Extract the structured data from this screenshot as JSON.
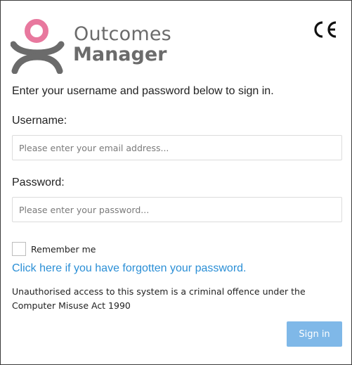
{
  "brand": {
    "line1": "Outcomes",
    "line2": "Manager",
    "logo_icon": "outcomes-person-logo-icon",
    "pink": "#e8789e",
    "grey": "#6b6b6b"
  },
  "certification": {
    "mark": "CE"
  },
  "form": {
    "intro": "Enter your username and password below to sign in.",
    "username_label": "Username:",
    "username_placeholder": "Please enter your email address...",
    "username_value": "",
    "password_label": "Password:",
    "password_placeholder": "Please enter your password...",
    "password_value": "",
    "remember_label": "Remember me",
    "remember_checked": false,
    "forgot_link": "Click here if you have forgotten your password.",
    "legal_notice": "Unauthorised access to this system is a criminal offence under the Computer Misuse Act 1990",
    "signin_label": "Sign in"
  },
  "colors": {
    "link": "#2b8fd6",
    "button_bg": "#7fb8e8",
    "button_text": "#ffffff",
    "border": "#dcdcdc"
  }
}
